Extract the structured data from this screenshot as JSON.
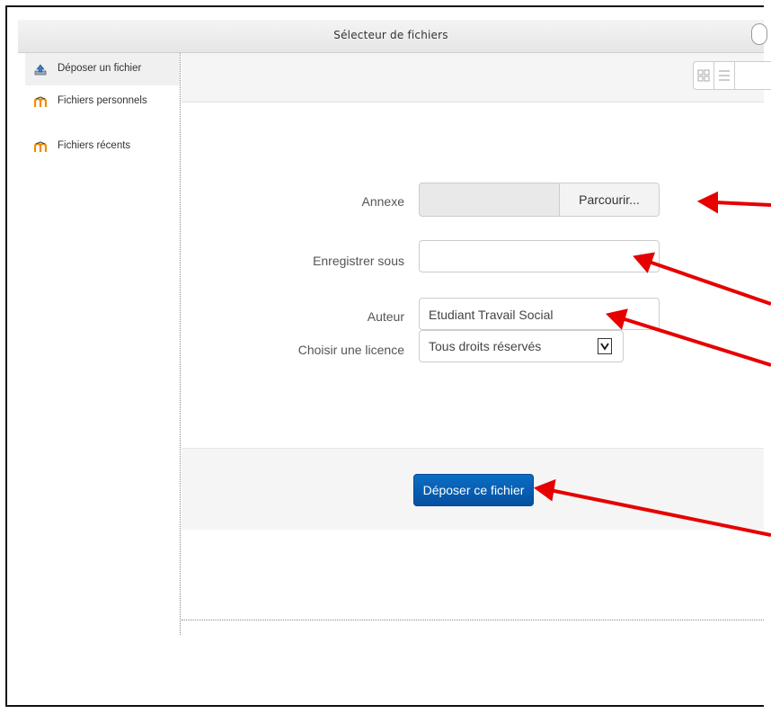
{
  "window": {
    "title": "Sélecteur de fichiers"
  },
  "sidebar": {
    "items": [
      {
        "label": "Déposer un fichier",
        "icon": "upload-icon",
        "active": true
      },
      {
        "label": "Fichiers personnels",
        "icon": "moodle-icon",
        "active": false
      },
      {
        "label": "Fichiers récents",
        "icon": "moodle-icon",
        "active": false
      }
    ]
  },
  "toolbar": {
    "view_buttons": [
      "grid-view-icon",
      "list-view-icon"
    ]
  },
  "form": {
    "attachment_label": "Annexe",
    "browse_label": "Parcourir...",
    "save_as_label": "Enregistrer sous",
    "save_as_value": "",
    "author_label": "Auteur",
    "author_value": "Etudiant Travail Social",
    "license_label": "Choisir une licence",
    "license_value": "Tous droits réservés"
  },
  "actions": {
    "upload_label": "Déposer ce fichier"
  },
  "colors": {
    "primary_button": "#0650a0",
    "annotation_arrow": "#e60000"
  }
}
